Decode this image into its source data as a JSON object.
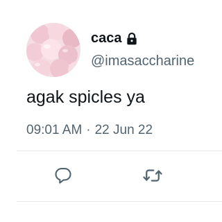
{
  "user": {
    "display_name": "caca",
    "handle": "@imasaccharine",
    "protected": true,
    "lock_icon": "lock-icon",
    "avatar_icon": "avatar-image"
  },
  "tweet": {
    "text": "agak spicles ya",
    "time": "09:01 AM",
    "separator": "·",
    "date": "22 Jun 22"
  },
  "actions": {
    "reply_icon": "reply-icon",
    "retweet_icon": "retweet-icon"
  },
  "colors": {
    "text_primary": "#0f1419",
    "text_secondary": "#536471",
    "icon": "#536471",
    "divider": "#e6e9eb"
  }
}
